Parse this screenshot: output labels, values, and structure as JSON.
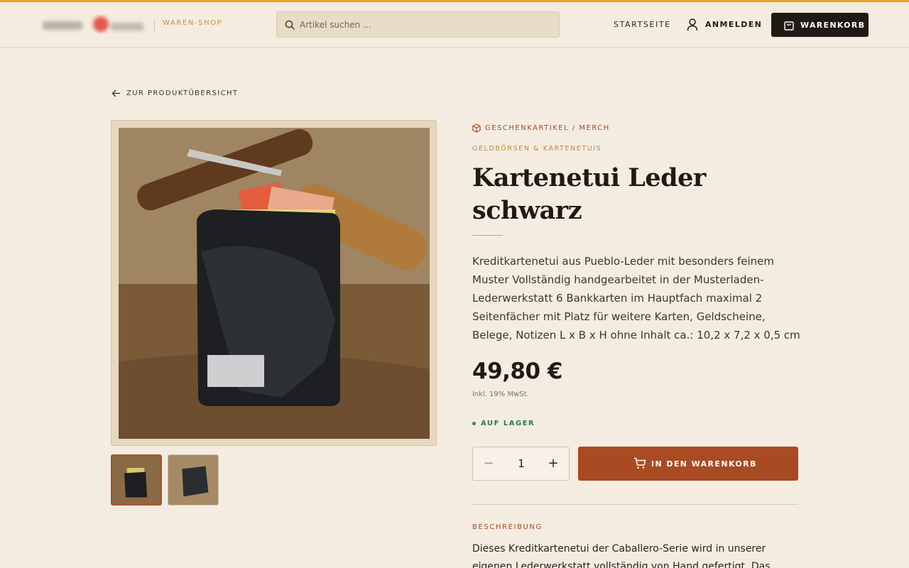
{
  "header": {
    "shop_label": "WAREN-SHOP",
    "search_placeholder": "Artikel suchen ...",
    "nav_home": "STARTSEITE",
    "login_label": "ANMELDEN",
    "cart_label": "WARENKORB",
    "accent_color": "#f0a020"
  },
  "page": {
    "back_label": "ZUR PRODUKTÜBERSICHT"
  },
  "product": {
    "category": "GESCHENKARTIKEL / MERCH",
    "subcategory": "GELDBÖRSEN & KARTENETUIS",
    "title": "Kartenetui Leder schwarz",
    "short_description": "Kreditkartenetui aus Pueblo-Leder mit besonders feinem Muster Vollständig handgearbeitet in der Musterladen-Lederwerkstatt 6 Bankkarten im Hauptfach maximal 2 Seitenfächer mit Platz für weitere Karten, Geldscheine, Belege, Notizen L x B x H ohne Inhalt ca.: 10,2 x 7,2 x 0,5 cm",
    "price": "49,80 €",
    "vat_note": "inkl. 19% MwSt.",
    "stock_status": "AUF LAGER",
    "stock_color": "#2f8a4a",
    "quantity": "1",
    "quantity_minus": "−",
    "quantity_plus": "+",
    "add_to_cart_label": "IN DEN WARENKORB",
    "button_color": "#a84a22",
    "description_heading": "BESCHREIBUNG",
    "description": "Dieses Kreditkartenetui der Caballero-Serie wird in unserer eigenen Lederwerkstatt vollständig von Hand gefertigt. Das Ergebnis besticht"
  },
  "icons": {
    "search": "search-icon",
    "user": "user-icon",
    "cart": "shopping-bag-icon",
    "back": "arrow-left-icon",
    "category": "box-icon",
    "add_cart": "cart-icon"
  }
}
